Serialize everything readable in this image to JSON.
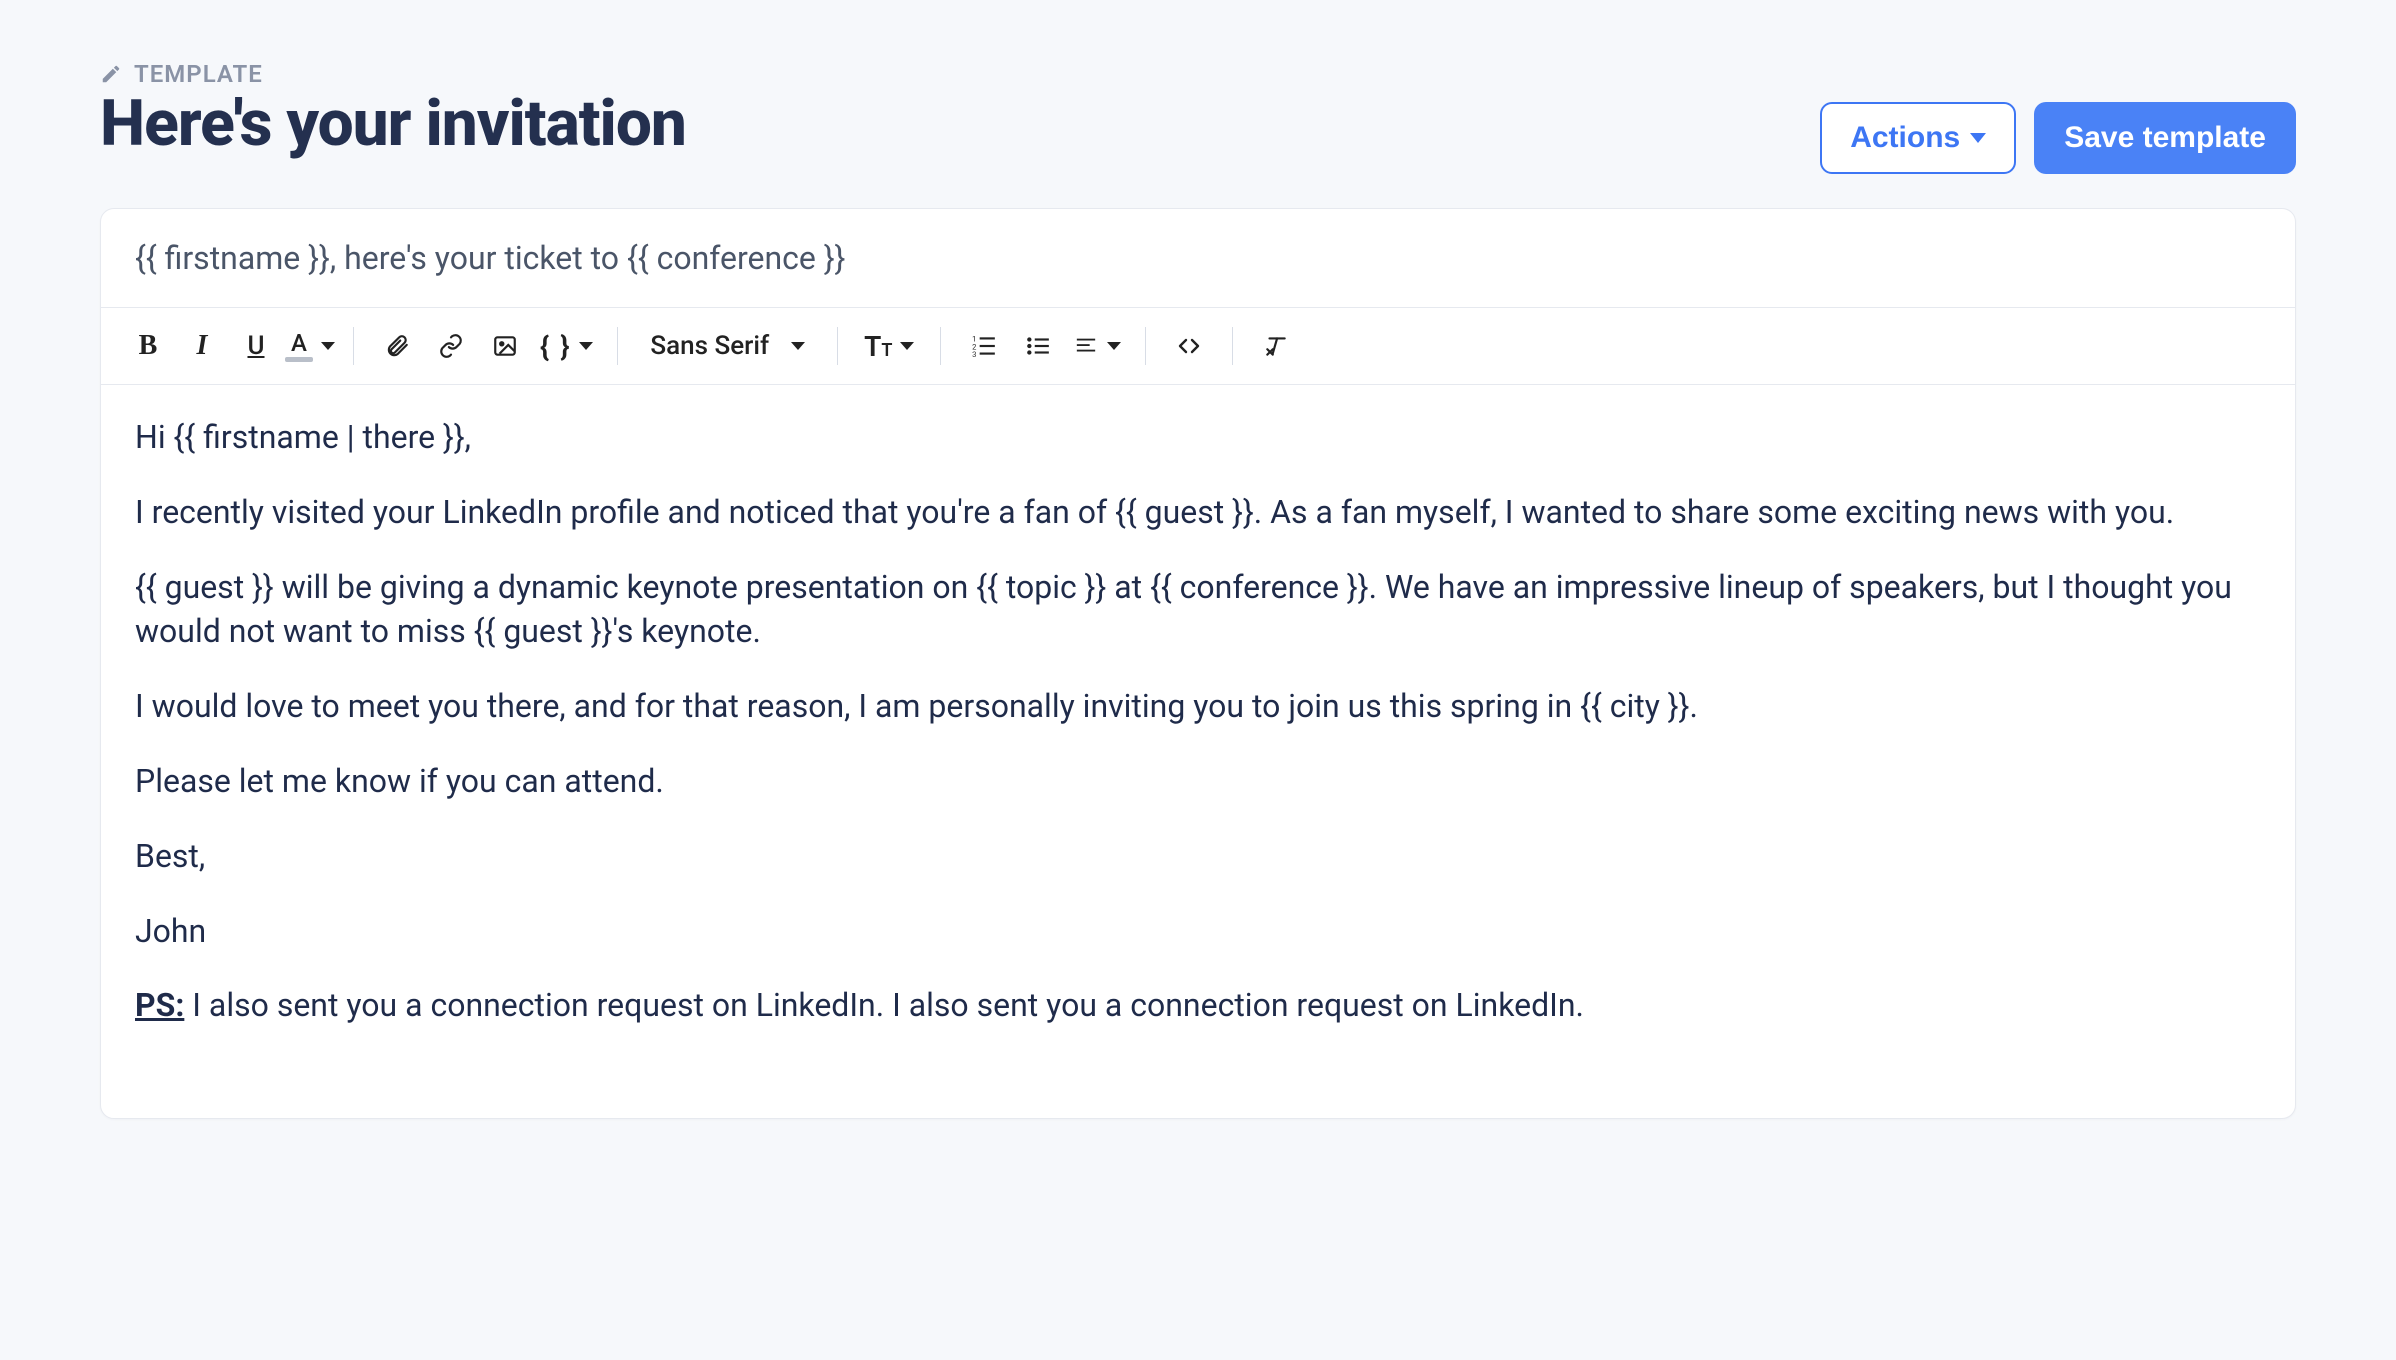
{
  "breadcrumb": {
    "label": "TEMPLATE"
  },
  "page": {
    "title": "Here's your invitation"
  },
  "header": {
    "actions_label": "Actions",
    "save_label": "Save template"
  },
  "subject": {
    "value": "{{ firstname }}, here's your ticket to {{ conference }}"
  },
  "toolbar": {
    "font_family": "Sans Serif"
  },
  "body": {
    "p1": "Hi {{ firstname | there }},",
    "p2": "I recently visited your LinkedIn profile and noticed that you're a fan of {{ guest }}. As a fan myself, I wanted to share some exciting news with you.",
    "p3": "{{ guest }} will be giving a dynamic keynote presentation on {{ topic }} at {{ conference }}. We have an impressive lineup of speakers, but I thought you would not want to miss {{ guest }}'s keynote.",
    "p4": "I would love to meet you there, and for that reason, I am personally inviting you to join us this spring in {{ city }}.",
    "p5": "Please let me know if you can attend.",
    "p6": "Best,",
    "p7": "John",
    "ps_label": "PS:",
    "ps_text": " I also sent you a connection request on LinkedIn. I also sent you a connection request on LinkedIn."
  }
}
